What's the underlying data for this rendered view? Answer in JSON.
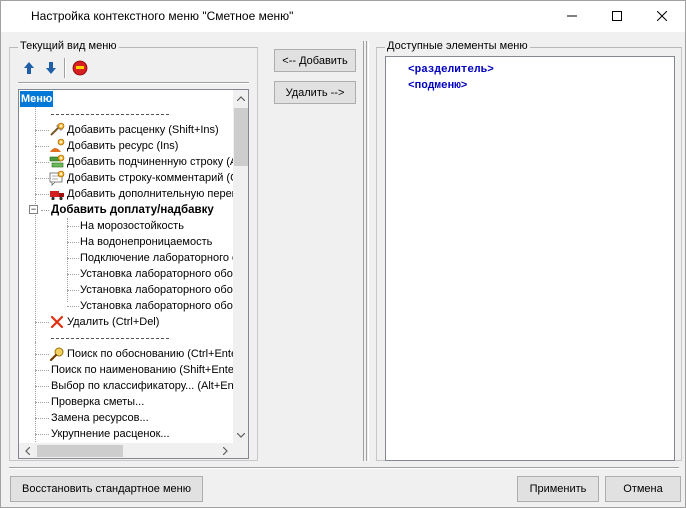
{
  "window": {
    "title": "Настройка контекстного меню \"Сметное меню\"",
    "min_glyph": "—",
    "max_glyph": "☐",
    "close_glyph": "✕"
  },
  "left_group": {
    "label": "Текущий вид меню",
    "toolbar": [
      "arrow-up-icon",
      "arrow-down-icon",
      "delete-red-icon"
    ]
  },
  "tree": {
    "root": "Меню",
    "separator1": "----------------------------------------",
    "items": [
      {
        "label": "Добавить расценку (Shift+Ins)",
        "icon": "add-rate-icon"
      },
      {
        "label": "Добавить ресурс (Ins)",
        "icon": "add-resource-icon"
      },
      {
        "label": "Добавить подчиненную строку (Alt+Ins)",
        "icon": "add-child-row-icon"
      },
      {
        "label": "Добавить строку-комментарий (Ctrl+Ins)",
        "icon": "add-comment-row-icon"
      },
      {
        "label": "Добавить дополнительную перевозку",
        "icon": "add-transport-icon"
      }
    ],
    "group_node": {
      "label": "Добавить доплату/надбавку",
      "expander": "−",
      "children": [
        "На морозостойкость",
        "На водонепроницаемость",
        "Подключение лабораторного обоснования",
        "Установка лабораторного обоснования",
        "Установка лабораторного обоснования",
        "Установка лабораторного обоснования"
      ]
    },
    "delete_item": "Удалить (Ctrl+Del)",
    "separator2": "----------------------------------------",
    "lower_items": [
      "Поиск по обоснованию (Ctrl+Enter)",
      "Поиск по наименованию (Shift+Enter)",
      "Выбор по классификатору... (Alt+Enter)",
      "Проверка сметы...",
      "Замена ресурсов...",
      "Укрупнение расценок..."
    ]
  },
  "buttons": {
    "add": "<-- Добавить",
    "remove": "Удалить -->",
    "restore": "Восстановить стандартное меню",
    "apply": "Применить",
    "cancel": "Отмена"
  },
  "right_group": {
    "label": "Доступные элементы меню",
    "items": [
      "<разделитель>",
      "<подменю>"
    ]
  },
  "colors": {
    "selection": "#0078d7",
    "available_text": "#0000c0",
    "window_bg": "#f0f0f0"
  }
}
